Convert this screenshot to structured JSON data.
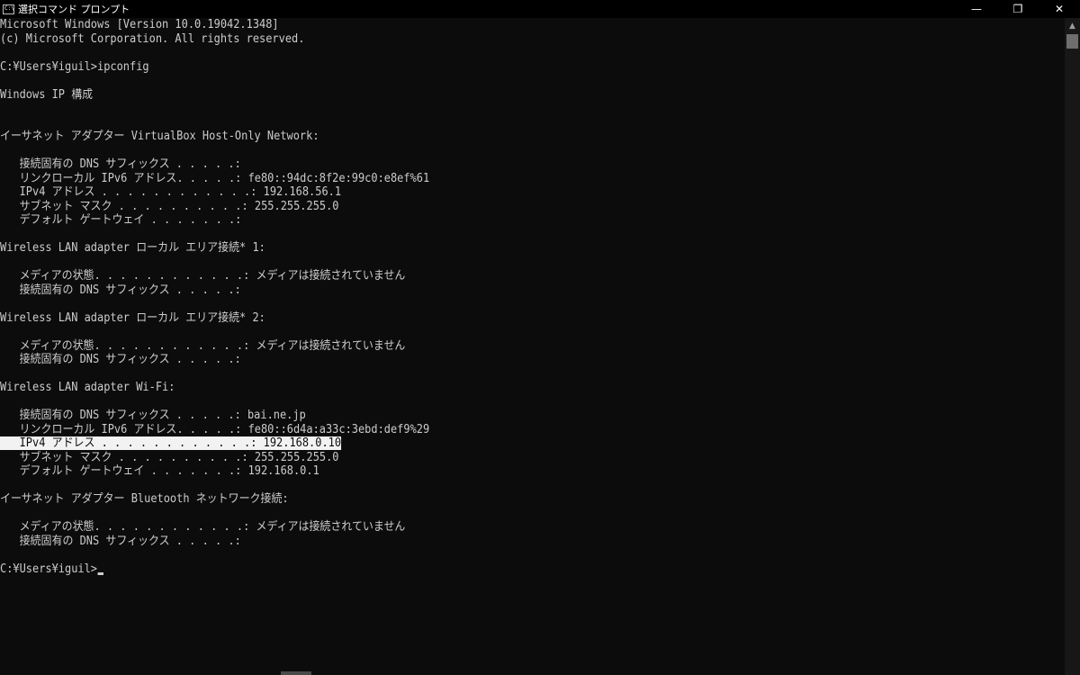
{
  "window": {
    "title": "選択コマンド プロンプト",
    "icon_text": "C:\\_",
    "buttons": {
      "minimize": "—",
      "restore": "❐",
      "close": "✕"
    }
  },
  "console": {
    "lines": [
      "Microsoft Windows [Version 10.0.19042.1348]",
      "(c) Microsoft Corporation. All rights reserved.",
      "",
      "C:¥Users¥iguil>ipconfig",
      "",
      "Windows IP 構成",
      "",
      "",
      "イーサネット アダプター VirtualBox Host-Only Network:",
      "",
      "   接続固有の DNS サフィックス . . . . .:",
      "   リンクローカル IPv6 アドレス. . . . .: fe80::94dc:8f2e:99c0:e8ef%61",
      "   IPv4 アドレス . . . . . . . . . . . .: 192.168.56.1",
      "   サブネット マスク . . . . . . . . . .: 255.255.255.0",
      "   デフォルト ゲートウェイ . . . . . . .:",
      "",
      "Wireless LAN adapter ローカル エリア接続* 1:",
      "",
      "   メディアの状態. . . . . . . . . . . .: メディアは接続されていません",
      "   接続固有の DNS サフィックス . . . . .:",
      "",
      "Wireless LAN adapter ローカル エリア接続* 2:",
      "",
      "   メディアの状態. . . . . . . . . . . .: メディアは接続されていません",
      "   接続固有の DNS サフィックス . . . . .:",
      "",
      "Wireless LAN adapter Wi-Fi:",
      "",
      "   接続固有の DNS サフィックス . . . . .: bai.ne.jp",
      "   リンクローカル IPv6 アドレス. . . . .: fe80::6d4a:a33c:3ebd:def9%29",
      "   IPv4 アドレス . . . . . . . . . . . .: 192.168.0.10",
      "   サブネット マスク . . . . . . . . . .: 255.255.255.0",
      "   デフォルト ゲートウェイ . . . . . . .: 192.168.0.1",
      "",
      "イーサネット アダプター Bluetooth ネットワーク接続:",
      "",
      "   メディアの状態. . . . . . . . . . . .: メディアは接続されていません",
      "   接続固有の DNS サフィックス . . . . .:",
      "",
      "C:¥Users¥iguil>"
    ],
    "selected_line": "IPv4 アドレス . . . . . . . . . . . .: 192.168.0.10"
  },
  "colors": {
    "background": "#0c0c0c",
    "text": "#cccccc",
    "selection": "#f2f2f2"
  },
  "icons": {
    "app": "cmd-icon",
    "scroll_up": "scroll-up-arrow-icon"
  }
}
